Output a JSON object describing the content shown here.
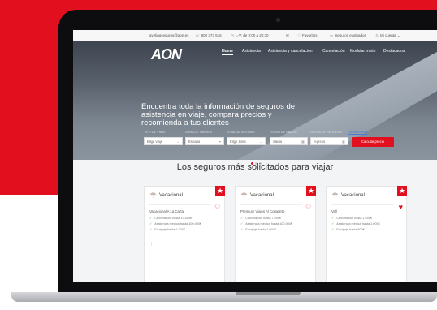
{
  "topbar": {
    "email": "avelingseguros@aon.es",
    "phone": "900 373 515",
    "hours": "L-V: de 9:00 a 20:30",
    "favorites": "Favoritos",
    "cart": "Seguros evaluados",
    "user": "Mi cuenta"
  },
  "brand": {
    "logo_text": "AON",
    "accent_color": "#e2101e"
  },
  "nav": {
    "items": [
      {
        "label": "Home"
      },
      {
        "label": "Asistencia"
      },
      {
        "label": "Asistencia y cancelación"
      },
      {
        "label": "Cancelación"
      },
      {
        "label": "Modular mixto"
      },
      {
        "label": "Destacados"
      }
    ]
  },
  "hero": {
    "headline": "Encuentra toda la información de seguros de asistencia en viaje, compara precios y recomienda a tus clientes"
  },
  "search": {
    "fields": [
      {
        "label": "TIPO DE VIAJE",
        "value": "Elige viaje"
      },
      {
        "label": "ZONA DE ORIGEN",
        "value": "España"
      },
      {
        "label": "ZONA DE DESTINO",
        "value": "Elige zona"
      },
      {
        "label": "FECHA DE SALIDA",
        "value": "salida"
      },
      {
        "label": "FECHA DE REGRESO",
        "value": "regreso"
      }
    ],
    "clear_link": "Limpiar filtros",
    "submit_label": "Calcular precio"
  },
  "section": {
    "title": "Los seguros más solicitados para viajar"
  },
  "cards": [
    {
      "category": "Vacacional",
      "name": "Vacacional A La Carta",
      "features": [
        "Cancelación hasta 10.000€",
        "Asistencia médica hasta 100.000€",
        "Equipaje hasta 1.000€"
      ]
    },
    {
      "category": "Vacacional",
      "name": "Premium Viajes Al Completo",
      "features": [
        "Cancelación hasta 7.000€",
        "Asistencia médica hasta 100.000€",
        "Equipaje hasta 1.000€"
      ]
    },
    {
      "category": "Vacacional",
      "name": "Vall",
      "features": [
        "Cancelación hasta 1.000€",
        "Asistencia médica hasta 1.000€",
        "Equipaje hasta 500€"
      ]
    }
  ]
}
